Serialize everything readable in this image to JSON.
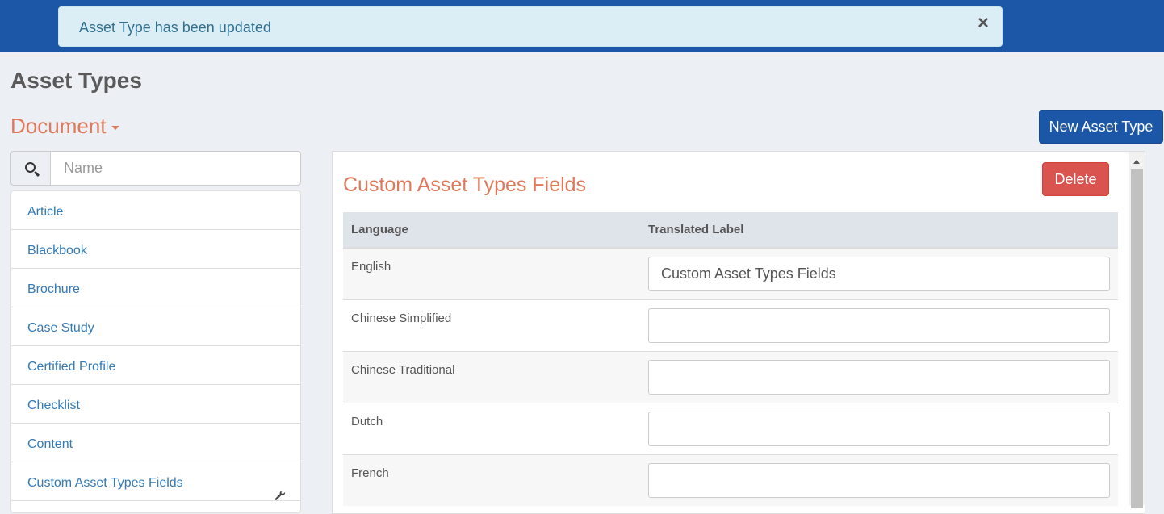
{
  "alert": {
    "message": "Asset Type has been updated",
    "close_glyph": "×"
  },
  "page_title": "Asset Types",
  "category_dropdown": {
    "selected": "Document"
  },
  "new_button_label": "New Asset Type",
  "search": {
    "placeholder": "Name",
    "value": ""
  },
  "asset_types": [
    {
      "label": "Article"
    },
    {
      "label": "Blackbook"
    },
    {
      "label": "Brochure"
    },
    {
      "label": "Case Study"
    },
    {
      "label": "Certified Profile"
    },
    {
      "label": "Checklist"
    },
    {
      "label": "Content"
    },
    {
      "label": "Custom Asset Types Fields",
      "icon": "wrench-icon"
    }
  ],
  "detail": {
    "title": "Custom Asset Types Fields",
    "delete_label": "Delete",
    "columns": [
      "Language",
      "Translated Label"
    ],
    "rows": [
      {
        "language": "English",
        "value": "Custom Asset Types Fields"
      },
      {
        "language": "Chinese Simplified",
        "value": ""
      },
      {
        "language": "Chinese Traditional",
        "value": ""
      },
      {
        "language": "Dutch",
        "value": ""
      },
      {
        "language": "French",
        "value": ""
      }
    ]
  },
  "colors": {
    "topbar": "#1b57a6",
    "accent": "#e0785a",
    "link": "#337ab7",
    "danger": "#d9534f",
    "alert_bg": "#dbeef5"
  }
}
